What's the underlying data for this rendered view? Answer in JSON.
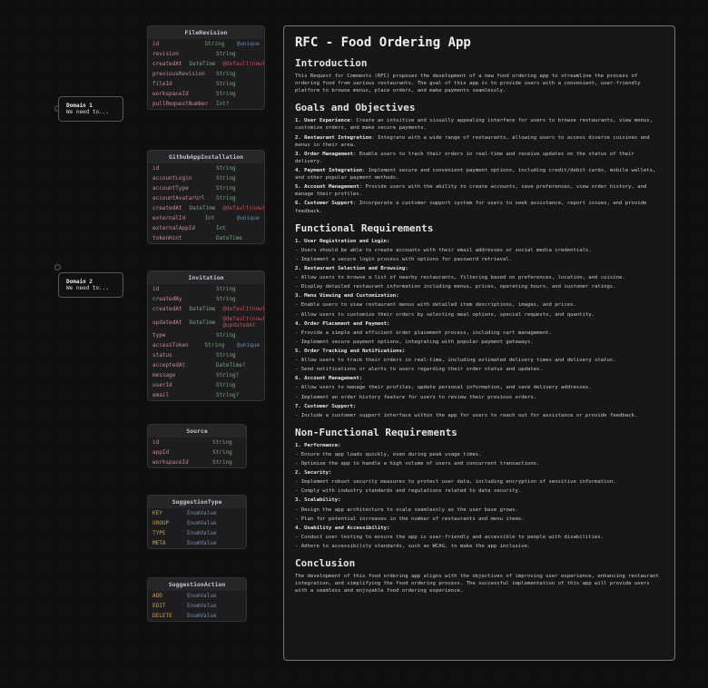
{
  "nodes": [
    {
      "id": "domain1",
      "title": "Domain 1",
      "sub": "We need to..."
    },
    {
      "id": "domain2",
      "title": "Domain 2",
      "sub": "We need to..."
    }
  ],
  "tables": {
    "FileRevision": {
      "title": "FileRevision",
      "cols": [
        {
          "f": "id",
          "t": "String",
          "a": "@unique"
        },
        {
          "f": "revision",
          "t": "String"
        },
        {
          "f": "createdAt",
          "t": "DateTime",
          "a": "@default(now())",
          "ac": "red"
        },
        {
          "f": "previousRevision",
          "t": "String"
        },
        {
          "f": "fileId",
          "t": "String"
        },
        {
          "f": "workspaceId",
          "t": "String"
        },
        {
          "f": "pullRequestNumber",
          "t": "Int?"
        }
      ]
    },
    "GithubAppInstallation": {
      "title": "GithubAppInstallation",
      "cols": [
        {
          "f": "id",
          "t": "String"
        },
        {
          "f": "accountLogin",
          "t": "String"
        },
        {
          "f": "accountType",
          "t": "String"
        },
        {
          "f": "accountAvatarUrl",
          "t": "String"
        },
        {
          "f": "createdAt",
          "t": "DateTime",
          "a": "@default(now())",
          "ac": "red"
        },
        {
          "f": "externalId",
          "t": "Int",
          "a": "@unique"
        },
        {
          "f": "externalAppId",
          "t": "Int"
        },
        {
          "f": "tokenHint",
          "t": "DateTime",
          "ac": "red"
        }
      ]
    },
    "Invitation": {
      "title": "Invitation",
      "cols": [
        {
          "f": "id",
          "t": "String"
        },
        {
          "f": "createdBy",
          "t": "String"
        },
        {
          "f": "createdAt",
          "t": "DateTime",
          "a": "@default(now())",
          "ac": "red"
        },
        {
          "f": "updatedAt",
          "t": "DateTime",
          "a": "@default(now()) @updatedAt",
          "ac": "red"
        },
        {
          "f": "type",
          "t": "String"
        },
        {
          "f": "accessToken",
          "t": "String",
          "a": "@unique"
        },
        {
          "f": "status",
          "t": "String"
        },
        {
          "f": "acceptedAt",
          "t": "DateTime?"
        },
        {
          "f": "message",
          "t": "String?"
        },
        {
          "f": "userId",
          "t": "String"
        },
        {
          "f": "email",
          "t": "String?"
        }
      ]
    },
    "Source": {
      "title": "Source",
      "cols": [
        {
          "f": "id",
          "t": "String"
        },
        {
          "f": "appId",
          "t": "String"
        },
        {
          "f": "workspaceId",
          "t": "String"
        }
      ]
    }
  },
  "enums": {
    "SuggestionType": {
      "title": "SuggestionType",
      "cols": [
        {
          "f": "KEY",
          "t": "EnumValue"
        },
        {
          "f": "GROUP",
          "t": "EnumValue"
        },
        {
          "f": "TYPE",
          "t": "EnumValue"
        },
        {
          "f": "META",
          "t": "EnumValue"
        }
      ]
    },
    "SuggestionAction": {
      "title": "SuggestionAction",
      "cols": [
        {
          "f": "ADD",
          "t": "EnumValue"
        },
        {
          "f": "EDIT",
          "t": "EnumValue"
        },
        {
          "f": "DELETE",
          "t": "EnumValue"
        }
      ]
    }
  },
  "doc": {
    "title": "RFC - Food Ordering App",
    "sections": [
      {
        "h": "Introduction",
        "p": [
          "This Request for Comments (RFC) proposes the development of a new food ordering app to streamline the process of ordering food from various restaurants. The goal of this app is to provide users with a convenient, user-friendly platform to browse menus, place orders, and make payments seamlessly."
        ]
      },
      {
        "h": "Goals and Objectives",
        "ol": [
          {
            "b": "User Experience",
            "t": ": Create an intuitive and visually appealing interface for users to browse restaurants, view menus, customize orders, and make secure payments."
          },
          {
            "b": "Restaurant Integration",
            "t": ": Integrate with a wide range of restaurants, allowing users to access diverse cuisines and menus in their area."
          },
          {
            "b": "Order Management",
            "t": ": Enable users to track their orders in real-time and receive updates on the status of their delivery."
          },
          {
            "b": "Payment Integration",
            "t": ": Implement secure and convenient payment options, including credit/debit cards, mobile wallets, and other popular payment methods."
          },
          {
            "b": "Account Management",
            "t": ": Provide users with the ability to create accounts, save preferences, view order history, and manage their profiles."
          },
          {
            "b": "Customer Support",
            "t": ": Incorporate a customer support system for users to seek assistance, report issues, and provide feedback."
          }
        ]
      },
      {
        "h": "Functional Requirements",
        "list": [
          {
            "b": "1. User Registration and Login:"
          },
          {
            "t": "- Users should be able to create accounts with their email addresses or social media credentials."
          },
          {
            "t": "- Implement a secure login process with options for password retrieval."
          },
          {
            "b": "2. Restaurant Selection and Browsing:"
          },
          {
            "t": "- Allow users to browse a list of nearby restaurants, filtering based on preferences, location, and cuisine."
          },
          {
            "t": "- Display detailed restaurant information including menus, prices, operating hours, and customer ratings."
          },
          {
            "b": "3. Menu Viewing and Customization:"
          },
          {
            "t": "- Enable users to view restaurant menus with detailed item descriptions, images, and prices."
          },
          {
            "t": "- Allow users to customize their orders by selecting meal options, special requests, and quantity."
          },
          {
            "b": "4. Order Placement and Payment:"
          },
          {
            "t": "- Provide a simple and efficient order placement process, including cart management."
          },
          {
            "t": "- Implement secure payment options, integrating with popular payment gateways."
          },
          {
            "b": "5. Order Tracking and Notifications:"
          },
          {
            "t": "- Allow users to track their orders in real-time, including estimated delivery times and delivery status."
          },
          {
            "t": "- Send notifications or alerts to users regarding their order status and updates."
          },
          {
            "b": "6. Account Management:"
          },
          {
            "t": "- Allow users to manage their profiles, update personal information, and save delivery addresses."
          },
          {
            "t": "- Implement an order history feature for users to review their previous orders."
          },
          {
            "b": "7. Customer Support:"
          },
          {
            "t": "- Include a customer support interface within the app for users to reach out for assistance or provide feedback."
          }
        ]
      },
      {
        "h": "Non-Functional Requirements",
        "list": [
          {
            "b": "1. Performance:"
          },
          {
            "t": "- Ensure the app loads quickly, even during peak usage times."
          },
          {
            "t": "- Optimize the app to handle a high volume of users and concurrent transactions."
          },
          {
            "b": "2. Security:"
          },
          {
            "t": "- Implement robust security measures to protect user data, including encryption of sensitive information."
          },
          {
            "t": "- Comply with industry standards and regulations related to data security."
          },
          {
            "b": "3. Scalability:"
          },
          {
            "t": "- Design the app architecture to scale seamlessly as the user base grows."
          },
          {
            "t": "- Plan for potential increases in the number of restaurants and menu items."
          },
          {
            "b": "4. Usability and Accessibility:"
          },
          {
            "t": "- Conduct user testing to ensure the app is user-friendly and accessible to people with disabilities."
          },
          {
            "t": "- Adhere to accessibility standards, such as WCAG, to make the app inclusive."
          }
        ]
      },
      {
        "h": "Conclusion",
        "p": [
          "The development of this food ordering app aligns with the objectives of improving user experience, enhancing restaurant integration, and simplifying the food ordering process. The successful implementation of this app will provide users with a seamless and enjoyable food ordering experience."
        ]
      }
    ]
  }
}
